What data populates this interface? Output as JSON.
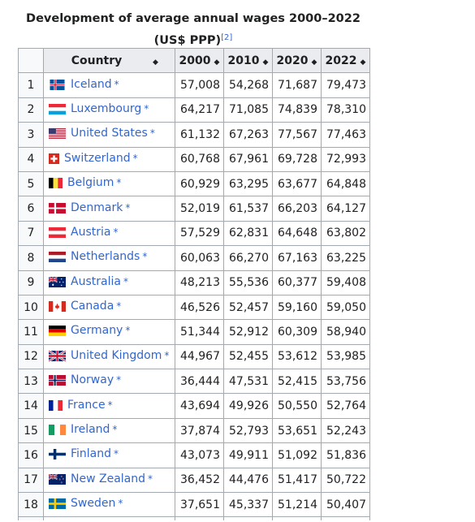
{
  "caption": {
    "title": "Development of average annual wages 2000–2022 (US$ PPP)",
    "ref": "[2]"
  },
  "headers": {
    "country": "Country",
    "y2000": "2000",
    "y2010": "2010",
    "y2020": "2020",
    "y2022": "2022",
    "sort_icon": "sort-icon"
  },
  "rows": [
    {
      "rank": "1",
      "country": "Iceland",
      "flag": "iceland-flag-icon",
      "v2000": "57,008",
      "v2010": "54,268",
      "v2020": "71,687",
      "v2022": "79,473"
    },
    {
      "rank": "2",
      "country": "Luxembourg",
      "flag": "luxembourg-flag-icon",
      "v2000": "64,217",
      "v2010": "71,085",
      "v2020": "74,839",
      "v2022": "78,310"
    },
    {
      "rank": "3",
      "country": "United States",
      "flag": "united-states-flag-icon",
      "v2000": "61,132",
      "v2010": "67,263",
      "v2020": "77,567",
      "v2022": "77,463"
    },
    {
      "rank": "4",
      "country": "Switzerland",
      "flag": "switzerland-flag-icon",
      "v2000": "60,768",
      "v2010": "67,961",
      "v2020": "69,728",
      "v2022": "72,993"
    },
    {
      "rank": "5",
      "country": "Belgium",
      "flag": "belgium-flag-icon",
      "v2000": "60,929",
      "v2010": "63,295",
      "v2020": "63,677",
      "v2022": "64,848"
    },
    {
      "rank": "6",
      "country": "Denmark",
      "flag": "denmark-flag-icon",
      "v2000": "52,019",
      "v2010": "61,537",
      "v2020": "66,203",
      "v2022": "64,127"
    },
    {
      "rank": "7",
      "country": "Austria",
      "flag": "austria-flag-icon",
      "v2000": "57,529",
      "v2010": "62,831",
      "v2020": "64,648",
      "v2022": "63,802"
    },
    {
      "rank": "8",
      "country": "Netherlands",
      "flag": "netherlands-flag-icon",
      "v2000": "60,063",
      "v2010": "66,270",
      "v2020": "67,163",
      "v2022": "63,225"
    },
    {
      "rank": "9",
      "country": "Australia",
      "flag": "australia-flag-icon",
      "v2000": "48,213",
      "v2010": "55,536",
      "v2020": "60,377",
      "v2022": "59,408"
    },
    {
      "rank": "10",
      "country": "Canada",
      "flag": "canada-flag-icon",
      "v2000": "46,526",
      "v2010": "52,457",
      "v2020": "59,160",
      "v2022": "59,050"
    },
    {
      "rank": "11",
      "country": "Germany",
      "flag": "germany-flag-icon",
      "v2000": "51,344",
      "v2010": "52,912",
      "v2020": "60,309",
      "v2022": "58,940"
    },
    {
      "rank": "12",
      "country": "United Kingdom",
      "flag": "united-kingdom-flag-icon",
      "v2000": "44,967",
      "v2010": "52,455",
      "v2020": "53,612",
      "v2022": "53,985"
    },
    {
      "rank": "13",
      "country": "Norway",
      "flag": "norway-flag-icon",
      "v2000": "36,444",
      "v2010": "47,531",
      "v2020": "52,415",
      "v2022": "53,756"
    },
    {
      "rank": "14",
      "country": "France",
      "flag": "france-flag-icon",
      "v2000": "43,694",
      "v2010": "49,926",
      "v2020": "50,550",
      "v2022": "52,764"
    },
    {
      "rank": "15",
      "country": "Ireland",
      "flag": "ireland-flag-icon",
      "v2000": "37,874",
      "v2010": "52,793",
      "v2020": "53,651",
      "v2022": "52,243"
    },
    {
      "rank": "16",
      "country": "Finland",
      "flag": "finland-flag-icon",
      "v2000": "43,073",
      "v2010": "49,911",
      "v2020": "51,092",
      "v2022": "51,836"
    },
    {
      "rank": "17",
      "country": "New Zealand",
      "flag": "new-zealand-flag-icon",
      "v2000": "36,452",
      "v2010": "44,476",
      "v2020": "51,417",
      "v2022": "50,722"
    },
    {
      "rank": "18",
      "country": "Sweden",
      "flag": "sweden-flag-icon",
      "v2000": "37,651",
      "v2010": "45,337",
      "v2020": "51,214",
      "v2022": "50,407"
    }
  ],
  "colors": {
    "link": "#3366cc",
    "header_bg": "#eaecf0",
    "border": "#a2a9b1"
  }
}
